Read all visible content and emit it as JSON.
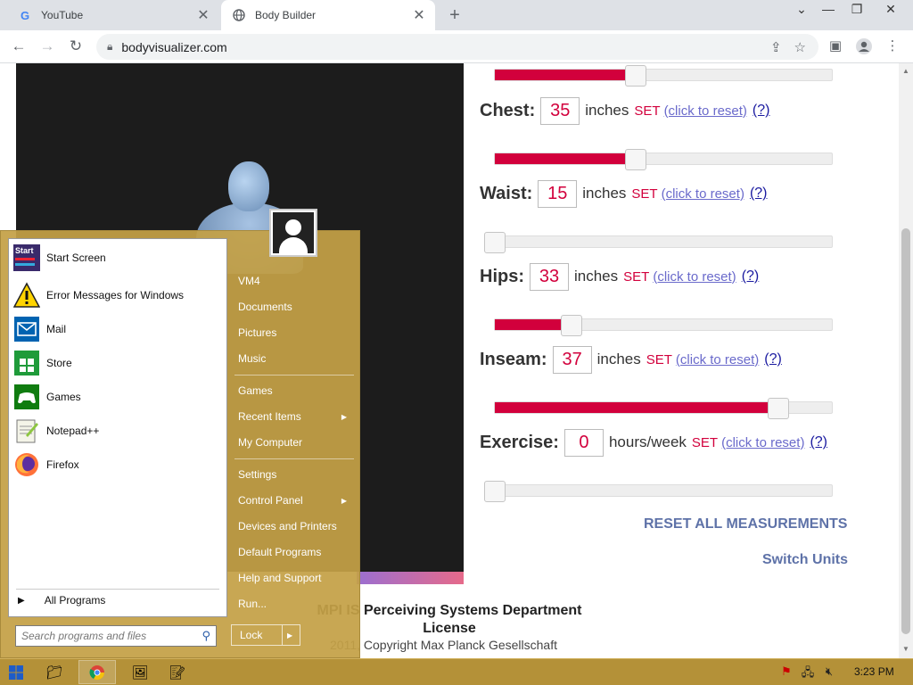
{
  "browser": {
    "tabs": [
      {
        "title": "YouTube",
        "favicon": "G"
      },
      {
        "title": "Body Builder",
        "favicon": "globe-icon"
      }
    ],
    "url": "bodyvisualizer.com"
  },
  "measurements": [
    {
      "label": "Chest:",
      "value": "35",
      "unit": "inches",
      "set": "SET",
      "reset": "(click to reset)",
      "help": "(?)",
      "fraction": 0.42
    },
    {
      "label": "Waist:",
      "value": "15",
      "unit": "inches",
      "set": "SET",
      "reset": "(click to reset)",
      "help": "(?)",
      "fraction": 0.0
    },
    {
      "label": "Hips:",
      "value": "33",
      "unit": "inches",
      "set": "SET",
      "reset": "(click to reset)",
      "help": "(?)",
      "fraction": 0.22
    },
    {
      "label": "Inseam:",
      "value": "37",
      "unit": "inches",
      "set": "SET",
      "reset": "(click to reset)",
      "help": "(?)",
      "fraction": 0.87
    },
    {
      "label": "Exercise:",
      "value": "0",
      "unit": "hours/week",
      "set": "SET",
      "reset": "(click to reset)",
      "help": "(?)",
      "fraction": 0.0
    }
  ],
  "top_slider_fraction": 0.42,
  "reset_all": "RESET ALL MEASUREMENTS",
  "switch_units": "Switch Units",
  "footer": {
    "line1": "MPI IS Perceiving Systems Department",
    "line2": "License",
    "copyright": "2011, Copyright Max Planck Gesellschaft"
  },
  "start_menu": {
    "pinned": [
      {
        "label": "Start Screen",
        "icon": "start-screen-icon"
      },
      {
        "label": "Error Messages for Windows",
        "icon": "warning-icon"
      },
      {
        "label": "Mail",
        "icon": "mail-icon"
      },
      {
        "label": "Store",
        "icon": "store-icon"
      },
      {
        "label": "Games",
        "icon": "games-icon"
      },
      {
        "label": "Notepad++",
        "icon": "notepad-icon"
      },
      {
        "label": "Firefox",
        "icon": "firefox-icon"
      }
    ],
    "all_programs": "All Programs",
    "search_placeholder": "Search programs and files",
    "right_items": [
      {
        "label": "VM4",
        "submenu": false
      },
      {
        "label": "Documents",
        "submenu": false
      },
      {
        "label": "Pictures",
        "submenu": false
      },
      {
        "label": "Music",
        "submenu": false
      },
      {
        "label": "Games",
        "submenu": false
      },
      {
        "label": "Recent Items",
        "submenu": true
      },
      {
        "label": "My Computer",
        "submenu": false
      },
      {
        "label": "Settings",
        "submenu": false
      },
      {
        "label": "Control Panel",
        "submenu": true
      },
      {
        "label": "Devices and Printers",
        "submenu": false
      },
      {
        "label": "Default Programs",
        "submenu": false
      },
      {
        "label": "Help and Support",
        "submenu": false
      },
      {
        "label": "Run...",
        "submenu": false
      }
    ],
    "lock_label": "Lock"
  },
  "taskbar": {
    "clock": "3:23 PM"
  }
}
